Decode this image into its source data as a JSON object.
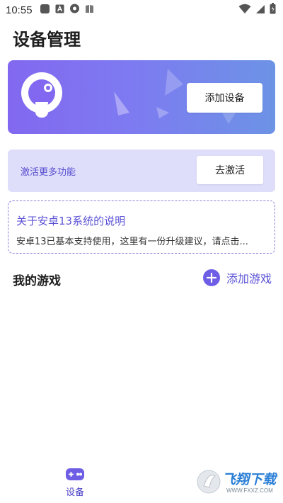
{
  "status_bar": {
    "time": "10:55"
  },
  "page": {
    "title": "设备管理"
  },
  "device_card": {
    "add_device_label": "添加设备"
  },
  "activate_card": {
    "text": "激活更多功能",
    "button_label": "去激活"
  },
  "notice": {
    "title": "关于安卓13系统的说明",
    "body": "安卓13已基本支持使用，这里有一份升级建议，请点击..."
  },
  "games": {
    "title": "我的游戏",
    "add_label": "添加游戏"
  },
  "tabbar": {
    "device_label": "设备"
  },
  "watermark": {
    "text": "飞翔下载",
    "url": "WWW.FXXZ.COM"
  },
  "colors": {
    "accent": "#6e5ee6",
    "card_gradient_start": "#8268f0",
    "card_gradient_end": "#6c93e6",
    "activate_bg": "#dedefb"
  }
}
